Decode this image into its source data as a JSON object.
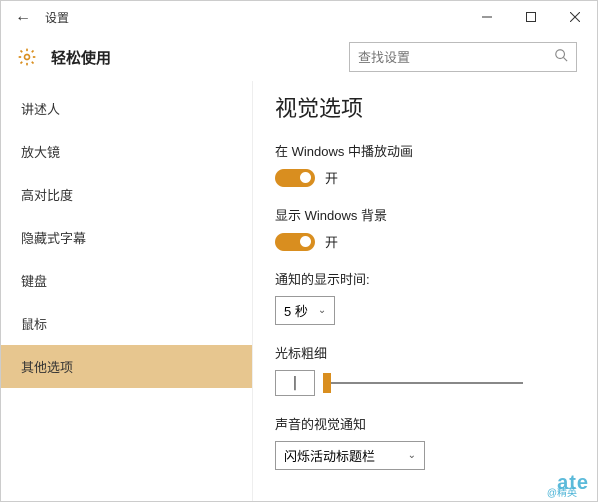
{
  "titlebar": {
    "title": "设置"
  },
  "header": {
    "app_title": "轻松使用"
  },
  "search": {
    "placeholder": "查找设置"
  },
  "sidebar": {
    "items": [
      {
        "label": "讲述人"
      },
      {
        "label": "放大镜"
      },
      {
        "label": "高对比度"
      },
      {
        "label": "隐藏式字幕"
      },
      {
        "label": "键盘"
      },
      {
        "label": "鼠标"
      },
      {
        "label": "其他选项"
      }
    ],
    "selected_index": 6
  },
  "content": {
    "heading": "视觉选项",
    "animations": {
      "label": "在 Windows 中播放动画",
      "state": "开"
    },
    "background": {
      "label": "显示 Windows 背景",
      "state": "开"
    },
    "notification_duration": {
      "label": "通知的显示时间:",
      "value": "5 秒"
    },
    "cursor_thickness": {
      "label": "光标粗细",
      "preview": "|"
    },
    "sound_visual": {
      "label": "声音的视觉通知",
      "value": "闪烁活动标题栏"
    }
  },
  "watermark": {
    "main": "ate",
    "sub": "@精英"
  }
}
